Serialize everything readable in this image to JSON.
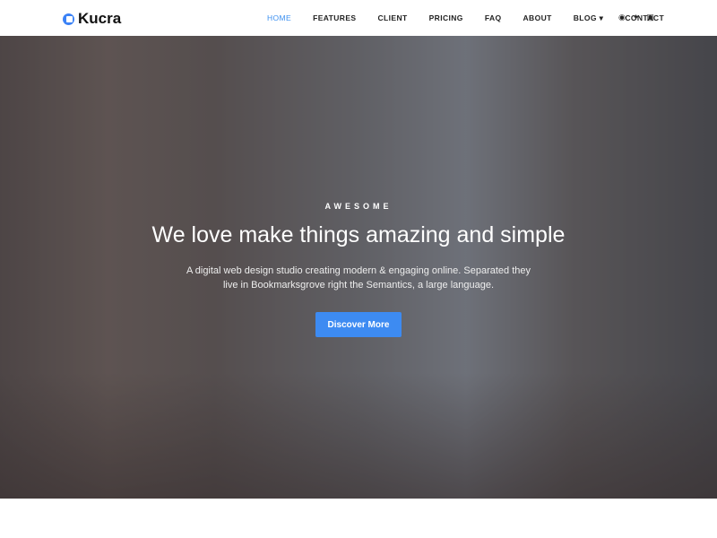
{
  "brand": {
    "name": "Kucra",
    "accent": "#3b8ff0"
  },
  "nav": {
    "items": [
      "HOME",
      "FEATURES",
      "CLIENT",
      "PRICING",
      "FAQ",
      "ABOUT",
      "BLOG ▾",
      "CONTACT"
    ],
    "active": "HOME"
  },
  "social": {
    "icons": [
      "facebook-icon",
      "twitter-icon",
      "instagram-icon"
    ]
  },
  "hero": {
    "kicker": "AWESOME",
    "title": "We love make things amazing and simple",
    "subtitle": "A digital web design studio creating modern & engaging online. Separated they live in Bookmarksgrove right the Semantics, a large language.",
    "button": "Discover More"
  }
}
